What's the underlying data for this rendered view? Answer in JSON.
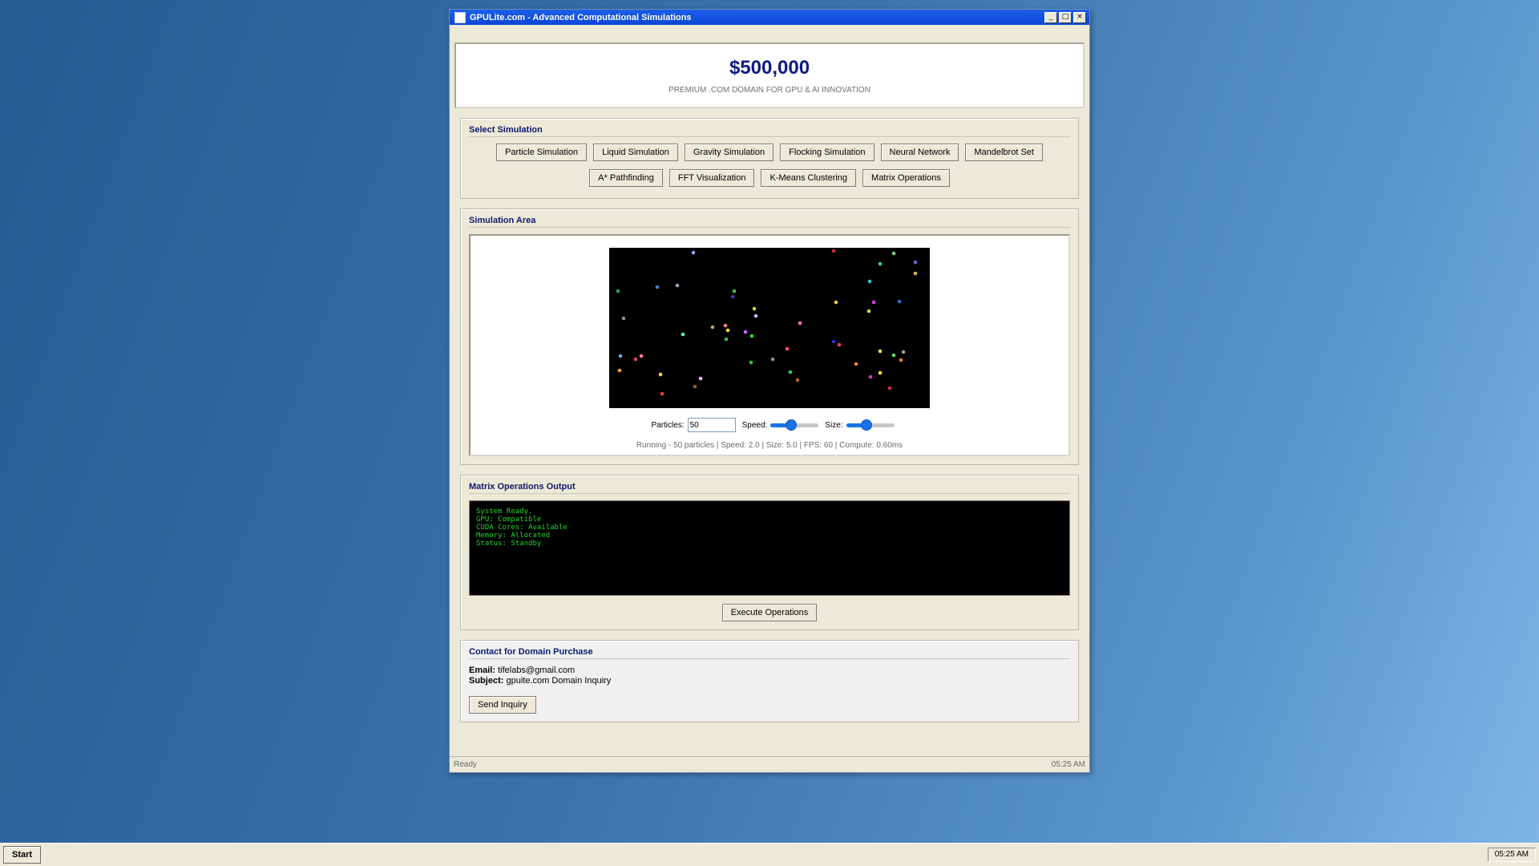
{
  "window": {
    "title": "GPULite.com - Advanced Computational Simulations",
    "minimize": "_",
    "maximize": "□",
    "close": "×"
  },
  "banner": {
    "price": "$500,000",
    "tagline": "PREMIUM .COM DOMAIN FOR GPU & AI INNOVATION"
  },
  "simulations": {
    "title": "Select Simulation",
    "row1": [
      "Particle Simulation",
      "Liquid Simulation",
      "Gravity Simulation",
      "Flocking Simulation",
      "Neural Network",
      "Mandelbrot Set"
    ],
    "row2": [
      "A* Pathfinding",
      "FFT Visualization",
      "K-Means Clustering",
      "Matrix Operations"
    ]
  },
  "simulation_area": {
    "title": "Simulation Area",
    "particles_label": "Particles:",
    "particles_value": "50",
    "speed_label": "Speed:",
    "speed_fraction": 0.4,
    "size_label": "Size:",
    "size_fraction": 0.4,
    "status": "Running - 50 particles | Speed: 2.0 | Size: 5.0 | FPS: 60 | Compute: 0.60ms"
  },
  "matrix_output": {
    "title": "Matrix Operations Output",
    "lines": [
      "System Ready.",
      "GPU: Compatible",
      "CUDA Cores: Available",
      "Memory: Allocated",
      "Status: Standby"
    ],
    "execute_label": "Execute Operations"
  },
  "contact": {
    "title": "Contact for Domain Purchase",
    "email_label": "Email:",
    "email_value": "tifelabs@gmail.com",
    "subject_label": "Subject:",
    "subject_value": "gpuite.com Domain Inquiry",
    "send_label": "Send Inquiry"
  },
  "statusbar": {
    "left": "Ready",
    "right": "05:25 AM"
  },
  "taskbar": {
    "start_label": "Start",
    "clock": "05:25 AM"
  },
  "colors": {
    "title_bar": "#0a46d6",
    "price_text": "#0c1a86",
    "console_text": "#24d62a",
    "slider_accent": "#1a73e8"
  }
}
